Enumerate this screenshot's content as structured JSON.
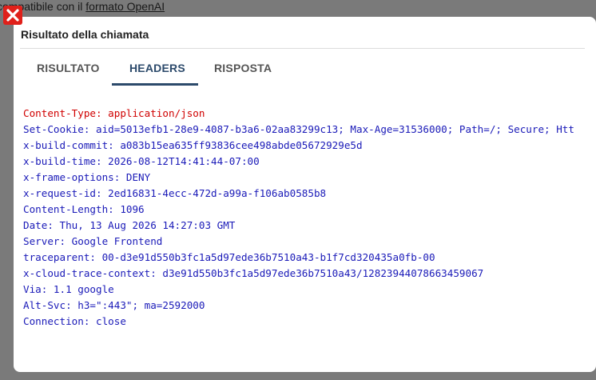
{
  "background": {
    "intro_text": "compatibile con il ",
    "link_text": "formato OpenAI"
  },
  "modal": {
    "title": "Risultato della chiamata",
    "tabs": [
      {
        "label": "RISULTATO",
        "active": false
      },
      {
        "label": "HEADERS",
        "active": true
      },
      {
        "label": "RISPOSTA",
        "active": false
      }
    ],
    "headers": [
      "Content-Type: application/json",
      "Set-Cookie: aid=5013efb1-28e9-4087-b3a6-02aa83299c13; Max-Age=31536000; Path=/; Secure; Htt",
      "x-build-commit: a083b15ea635ff93836cee498abde05672929e5d",
      "x-build-time: 2026-08-12T14:41:44-07:00",
      "x-frame-options: DENY",
      "x-request-id: 2ed16831-4ecc-472d-a99a-f106ab0585b8",
      "Content-Length: 1096",
      "Date: Thu, 13 Aug 2026 14:27:03 GMT",
      "Server: Google Frontend",
      "traceparent: 00-d3e91d550b3fc1a5d97ede36b7510a43-b1f7cd320435a0fb-00",
      "x-cloud-trace-context: d3e91d550b3fc1a5d97ede36b7510a43/12823944078663459067",
      "Via: 1.1 google",
      "Alt-Svc: h3=\":443\"; ma=2592000",
      "Connection: close"
    ]
  },
  "colors": {
    "accent": "#2c4a6b",
    "header_text": "#1a1ab8",
    "highlight_text": "#d00000",
    "close_button": "#e0201a"
  },
  "icons": {
    "close": "close-icon"
  }
}
